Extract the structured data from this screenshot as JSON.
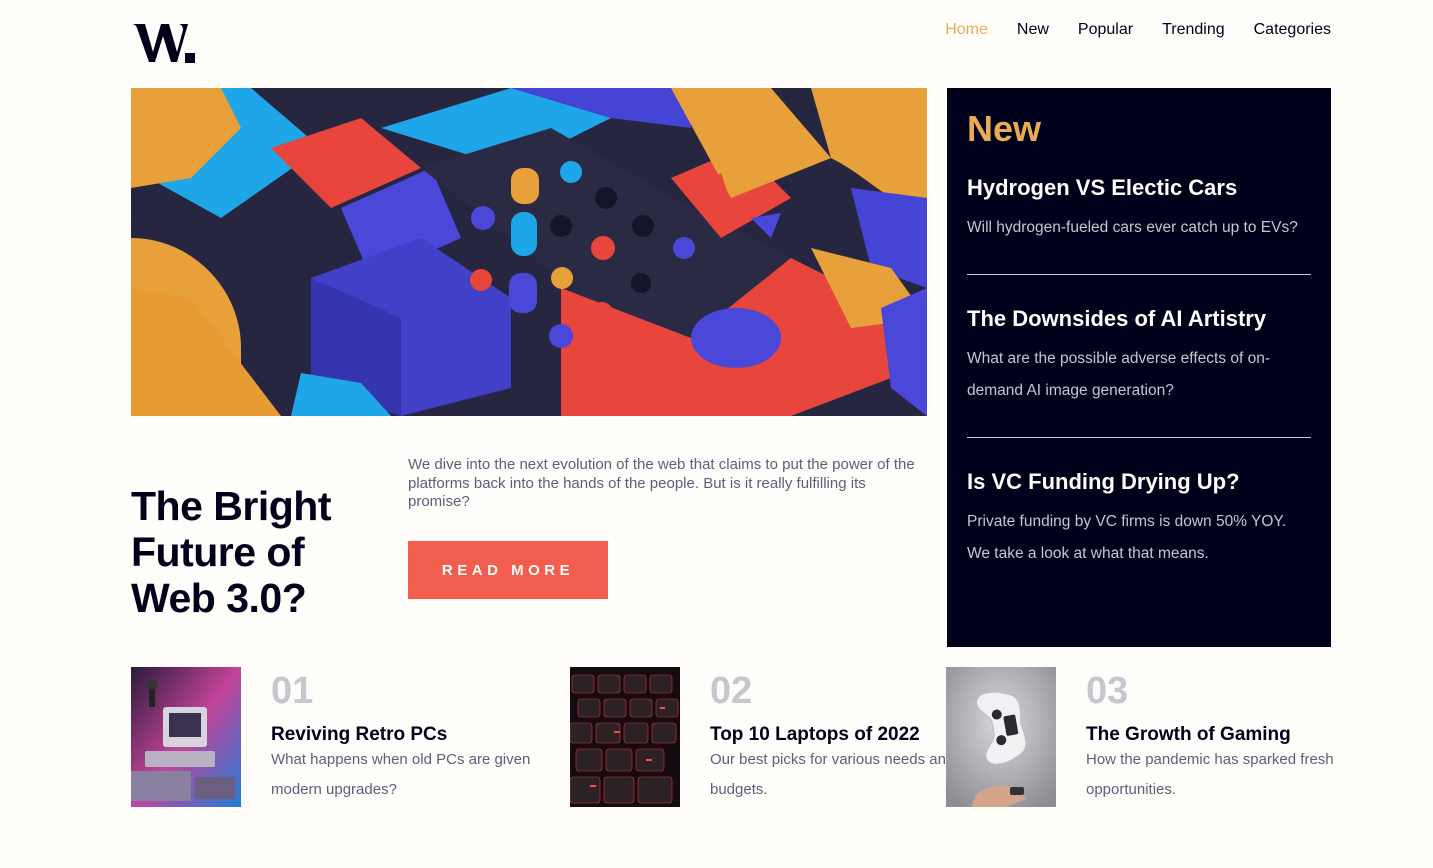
{
  "brand": {
    "logo_text": "W."
  },
  "nav": [
    {
      "label": "Home",
      "active": true
    },
    {
      "label": "New",
      "active": false
    },
    {
      "label": "Popular",
      "active": false
    },
    {
      "label": "Trending",
      "active": false
    },
    {
      "label": "Categories",
      "active": false
    }
  ],
  "hero": {
    "title": "The Bright Future of Web 3.0?",
    "description": "We dive into the next evolution of the web that claims to put the power of the platforms back into the hands of the people. But is it really fulfilling its promise?",
    "button_label": "READ MORE"
  },
  "new_panel": {
    "heading": "New",
    "items": [
      {
        "title": "Hydrogen VS Electic Cars",
        "description": "Will hydrogen-fueled cars ever catch up to EVs?"
      },
      {
        "title": "The Downsides of AI Artistry",
        "description": "What are the possible adverse effects of on-demand AI image generation?"
      },
      {
        "title": "Is VC Funding Drying Up?",
        "description": "Private funding by VC firms is down 50% YOY. We take a look at what that means."
      }
    ]
  },
  "cards": [
    {
      "number": "01",
      "title": "Reviving Retro PCs",
      "description": "What happens when old PCs are given modern upgrades?"
    },
    {
      "number": "02",
      "title": "Top 10 Laptops of 2022",
      "description": "Our best picks for various needs and budgets."
    },
    {
      "number": "03",
      "title": "The Growth of Gaming",
      "description": "How the pandemic has sparked fresh opportunities."
    }
  ],
  "colors": {
    "background": "#fffdfa",
    "dark_navy": "#00001a",
    "accent_orange": "#e9ab53",
    "accent_red": "#f15e50",
    "muted_gray": "#c5c6ce",
    "text_gray": "#5d5f79"
  }
}
